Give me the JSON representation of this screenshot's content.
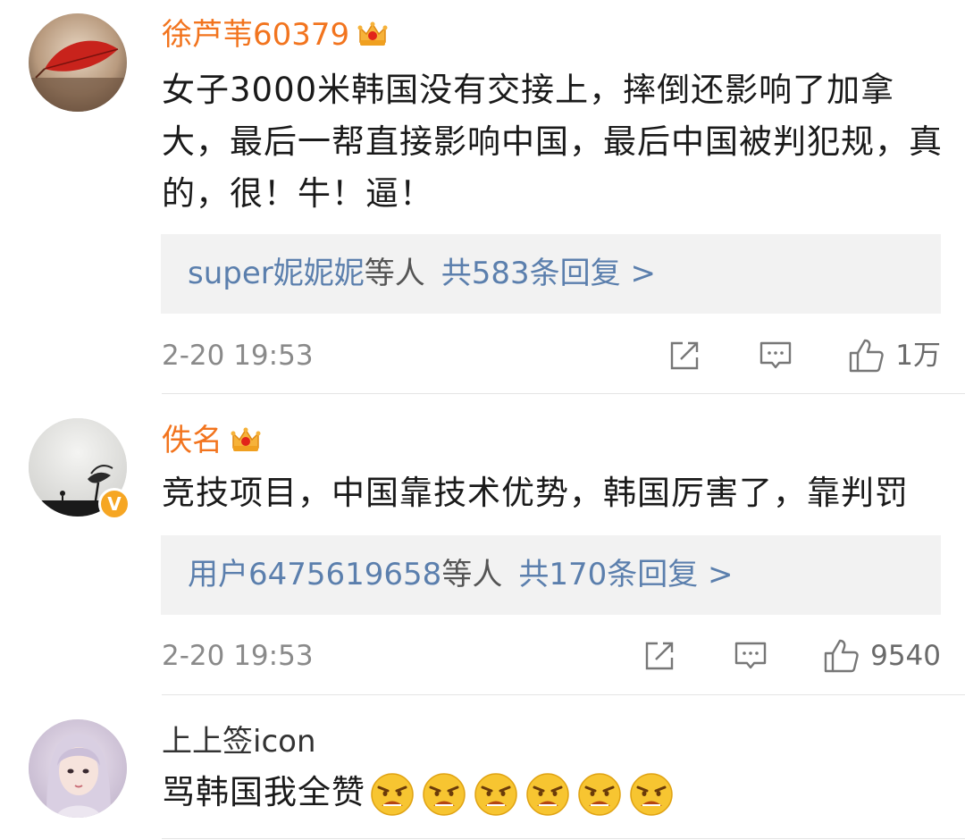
{
  "comments": [
    {
      "username": "徐芦苇60379",
      "is_vip": true,
      "text": "女子3000米韩国没有交接上，摔倒还影响了加拿大，最后一帮直接影响中国，最后中国被判犯规，真的，很！牛！逼！",
      "reply_who": "super妮妮妮",
      "reply_suffix": "等人",
      "reply_count": "共583条回复 >",
      "time": "2-20 19:53",
      "likes": "1万"
    },
    {
      "username": "佚名",
      "is_vip": true,
      "verified": true,
      "text": "竞技项目，中国靠技术优势，韩国厉害了，靠判罚",
      "reply_who": "用户6475619658",
      "reply_suffix": "等人",
      "reply_count": "共170条回复 >",
      "time": "2-20 19:53",
      "likes": "9540"
    },
    {
      "username": "上上签icon",
      "is_vip": false,
      "text": "骂韩国我全赞",
      "emoji_count": 6,
      "emoji_name": "angry-face-emoji"
    }
  ],
  "colors": {
    "vip_name": "#f2741e",
    "link": "#5b7fad",
    "reply_bg": "#f2f2f2",
    "meta": "#8a8a8a",
    "verified": "#f6a623"
  },
  "icons": [
    "crown-vip-icon",
    "repost-icon",
    "comment-icon",
    "like-thumb-icon",
    "verified-v-icon"
  ]
}
